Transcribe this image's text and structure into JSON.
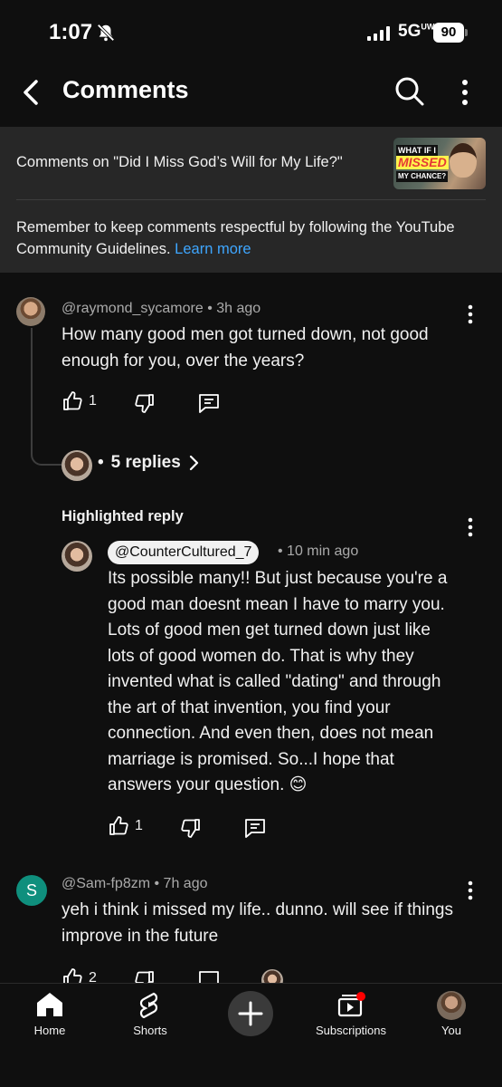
{
  "status_bar": {
    "time": "1:07",
    "network": "5G",
    "network_sup": "UW",
    "battery": "90"
  },
  "header": {
    "title": "Comments"
  },
  "info_card": {
    "video_line": "Comments on \"Did I Miss God’s Will for My Life?\"",
    "thumbnail_text": [
      "WHAT IF I",
      "MISSED",
      "MY CHANCE?"
    ],
    "guidelines": "Remember to keep comments respectful by following the YouTube Community Guidelines.",
    "learn_more": "Learn more"
  },
  "comments": [
    {
      "author": "@raymond_sycamore",
      "age": "3h ago",
      "text": "How many good men got turned down, not good enough for you, over the years?",
      "likes": "1",
      "replies_label": "5 replies"
    },
    {
      "section_label": "Highlighted reply",
      "author": "@CounterCultured_7",
      "age": "10 min ago",
      "text": "Its possible many!! But just because you're a good man doesnt mean I have to marry you. Lots of good men get turned down just like lots of good women do. That is why they invented what is called \"dating\" and through the art of that invention, you find your connection. And even then, does not mean marriage is promised. So...I hope that answers your question. 😊",
      "likes": "1"
    },
    {
      "avatar_letter": "S",
      "author": "@Sam-fp8zm",
      "age": "7h ago",
      "text": "yeh i think i missed my life.. dunno. will see if things improve in the future",
      "likes": "2"
    }
  ],
  "bottom_nav": {
    "items": [
      {
        "label": "Home",
        "icon": "home-icon"
      },
      {
        "label": "Shorts",
        "icon": "shorts-icon"
      },
      {
        "label": "",
        "icon": "create-plus-icon"
      },
      {
        "label": "Subscriptions",
        "icon": "subscriptions-icon"
      },
      {
        "label": "You",
        "icon": "avatar"
      }
    ]
  },
  "colors": {
    "background": "#0f0f0f",
    "card": "#272727",
    "link": "#3ea6ff",
    "notification": "#ff0000"
  }
}
